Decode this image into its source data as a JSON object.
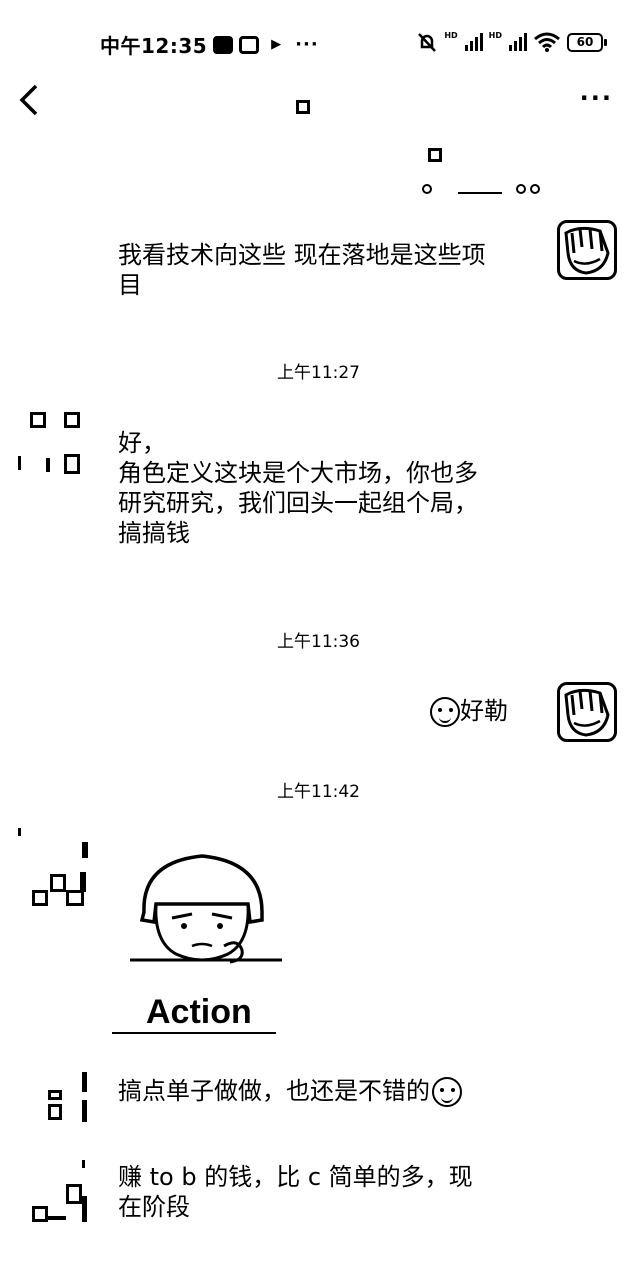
{
  "status_bar": {
    "time": "中午12:35",
    "more_dots": "···",
    "hd_label": "HD",
    "battery": "60"
  },
  "header": {
    "back_icon": "chevron-left-icon",
    "more": "···"
  },
  "messages": [
    {
      "side": "right",
      "text": "我看技术向这些 现在落地是这些项\n目"
    },
    {
      "timestamp": "上午11:27"
    },
    {
      "side": "left",
      "text": "好，\n角色定义这块是个大市场，你也多\n研究研究，我们回头一起组个局，\n搞搞钱"
    },
    {
      "timestamp": "上午11:36"
    },
    {
      "side": "right",
      "text": "好勒"
    },
    {
      "timestamp": "上午11:42"
    },
    {
      "side": "left",
      "type": "image",
      "caption": "Action"
    },
    {
      "side": "left",
      "text": "搞点单子做做，也还是不错的"
    },
    {
      "side": "left",
      "text": "赚 to b 的钱，比 c 简单的多，现\n在阶段"
    }
  ]
}
